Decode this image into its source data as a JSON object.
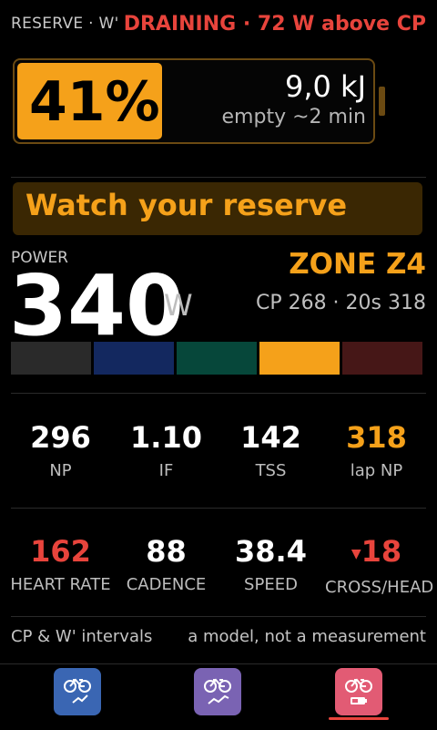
{
  "header": {
    "left": "RESERVE · W'",
    "right": "DRAINING · 72 W above CP"
  },
  "battery": {
    "percent_text": "41%",
    "percent": 41,
    "energy": "9,0 kJ",
    "empty": "empty ~2 min"
  },
  "alert": {
    "text": "Watch your reserve"
  },
  "power": {
    "label": "POWER",
    "value": "340",
    "unit": "W",
    "zone": "ZONE Z4",
    "cp_line": "CP 268 · 20s 318",
    "zone_colors": [
      "#2a2a2a",
      "#13285f",
      "#06473a",
      "#f5a11a",
      "#461717"
    ]
  },
  "metrics_row1": [
    {
      "value": "296",
      "label": "NP",
      "color": "#ffffff"
    },
    {
      "value": "1.10",
      "label": "IF",
      "color": "#ffffff"
    },
    {
      "value": "142",
      "label": "TSS",
      "color": "#ffffff"
    },
    {
      "value": "318",
      "label": "lap NP",
      "color": "#f5a11a"
    }
  ],
  "metrics_row2": [
    {
      "value": "162",
      "label": "HEART RATE",
      "color": "#e8443c"
    },
    {
      "value": "88",
      "label": "CADENCE",
      "color": "#ffffff"
    },
    {
      "value": "38.4",
      "label": "SPEED",
      "color": "#ffffff"
    },
    {
      "value": "18",
      "label": "CROSS/HEAD",
      "color": "#e8443c",
      "arrow": "▼"
    }
  ],
  "footer": {
    "left": "CP & W' intervals",
    "right": "a model, not a measurement"
  },
  "nav": [
    {
      "icon": "bike-trend-icon",
      "color": "#3a66b3",
      "active": false
    },
    {
      "icon": "bike-chart-icon",
      "color": "#7a63b3",
      "active": false
    },
    {
      "icon": "bike-battery-icon",
      "color": "#e25b74",
      "active": true
    }
  ]
}
